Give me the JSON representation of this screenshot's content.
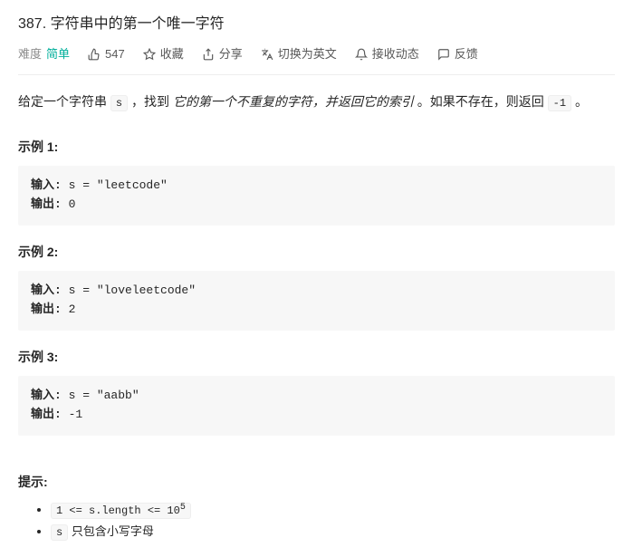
{
  "title": "387. 字符串中的第一个唯一字符",
  "meta": {
    "difficulty_label": "难度",
    "difficulty_value": "简单",
    "likes": "547",
    "favorite": "收藏",
    "share": "分享",
    "switch_lang": "切换为英文",
    "subscribe": "接收动态",
    "feedback": "反馈"
  },
  "description": {
    "prefix": "给定一个字符串 ",
    "var_s": "s",
    "mid": " ，找到 ",
    "italic": "它的第一个不重复的字符，并返回它的索引",
    "suffix1": " 。如果不存在，则返回 ",
    "neg1": "-1",
    "suffix2": " 。"
  },
  "examples": [
    {
      "label": "示例 1:",
      "input_label": "输入:",
      "input_val": " s = \"leetcode\"",
      "output_label": "输出:",
      "output_val": " 0"
    },
    {
      "label": "示例 2:",
      "input_label": "输入:",
      "input_val": " s = \"loveleetcode\"",
      "output_label": "输出:",
      "output_val": " 2"
    },
    {
      "label": "示例 3:",
      "input_label": "输入:",
      "input_val": " s = \"aabb\"",
      "output_label": "输出:",
      "output_val": " -1"
    }
  ],
  "hints_label": "提示:",
  "constraints": {
    "c1_code": "1 <= s.length <= 10",
    "c1_sup": "5",
    "c2_code": "s",
    "c2_text": " 只包含小写字母"
  }
}
